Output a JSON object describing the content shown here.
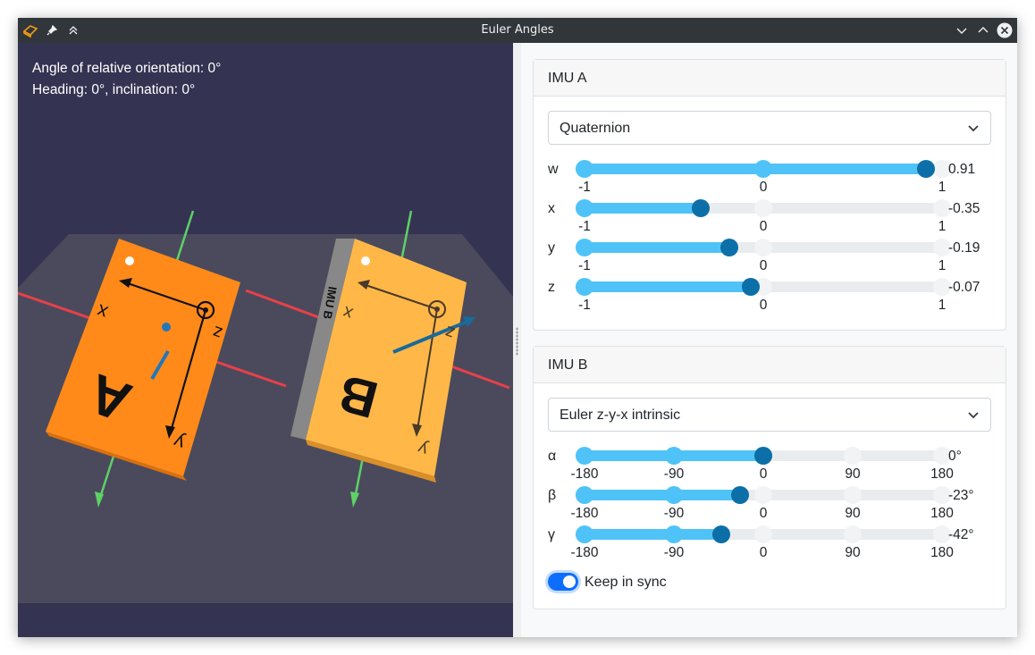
{
  "window": {
    "title": "Euler Angles"
  },
  "viewport": {
    "relative_orientation": "Angle of relative orientation: 0°",
    "heading_inclination": "Heading: 0°, inclination: 0°",
    "box_a": {
      "letter": "A",
      "axis_x": "x",
      "axis_y": "y",
      "axis_z": "z",
      "color": "#ff8c1a"
    },
    "box_b": {
      "letter": "B",
      "axis_x": "x",
      "axis_y": "y",
      "axis_z": "z",
      "side_label": "IMU B",
      "color": "#ffb84d"
    }
  },
  "imu_a": {
    "title": "IMU A",
    "mode": "Quaternion",
    "sliders": [
      {
        "label": "w",
        "value": 0.91,
        "value_text": "0.91",
        "min": -1,
        "max": 1,
        "ticks": [
          "-1",
          "0",
          "1"
        ]
      },
      {
        "label": "x",
        "value": -0.35,
        "value_text": "-0.35",
        "min": -1,
        "max": 1,
        "ticks": [
          "-1",
          "0",
          "1"
        ]
      },
      {
        "label": "y",
        "value": -0.19,
        "value_text": "-0.19",
        "min": -1,
        "max": 1,
        "ticks": [
          "-1",
          "0",
          "1"
        ]
      },
      {
        "label": "z",
        "value": -0.07,
        "value_text": "-0.07",
        "min": -1,
        "max": 1,
        "ticks": [
          "-1",
          "0",
          "1"
        ]
      }
    ]
  },
  "imu_b": {
    "title": "IMU B",
    "mode": "Euler z-y-x intrinsic",
    "sliders": [
      {
        "label": "α",
        "value": 0,
        "value_text": "0°",
        "min": -180,
        "max": 180,
        "ticks": [
          "-180",
          "-90",
          "0",
          "90",
          "180"
        ]
      },
      {
        "label": "β",
        "value": -23,
        "value_text": "-23°",
        "min": -180,
        "max": 180,
        "ticks": [
          "-180",
          "-90",
          "0",
          "90",
          "180"
        ]
      },
      {
        "label": "γ",
        "value": -42,
        "value_text": "-42°",
        "min": -180,
        "max": 180,
        "ticks": [
          "-180",
          "-90",
          "0",
          "90",
          "180"
        ]
      }
    ],
    "keep_in_sync_label": "Keep in sync",
    "keep_in_sync": true
  },
  "colors": {
    "accent": "#4fc3f7",
    "thumb": "#0d6fa8",
    "toggle": "#0d6efd"
  }
}
